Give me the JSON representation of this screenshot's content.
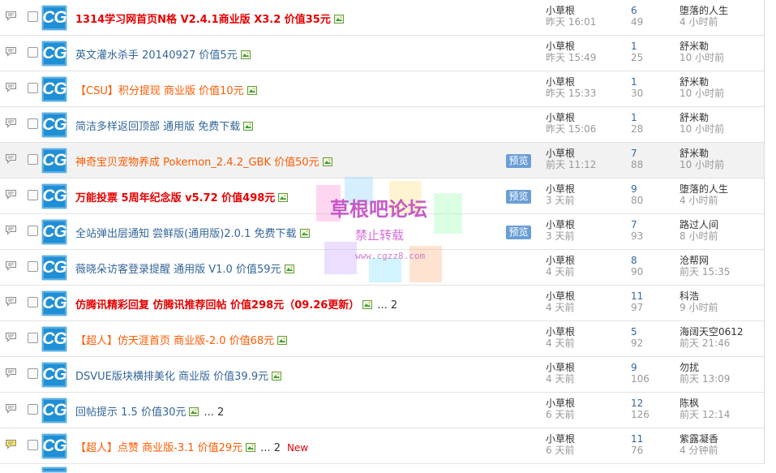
{
  "threads": [
    {
      "title": "1314学习网首页N格 V2.4.1商业版 X3.2 价值35元",
      "style": "red bold",
      "author": "小草根",
      "date": "昨天 16:01",
      "replies": "6",
      "views": "49",
      "last_user": "堕落的人生",
      "last_time": "4 小时前"
    },
    {
      "title": "英文灌水杀手 20140927 价值5元",
      "style": "",
      "author": "小草根",
      "date": "昨天 15:49",
      "replies": "1",
      "views": "25",
      "last_user": "舒米勒",
      "last_time": "10 小时前"
    },
    {
      "title": "【CSU】积分提现 商业版 价值10元",
      "style": "orange",
      "author": "小草根",
      "date": "昨天 15:33",
      "replies": "1",
      "views": "30",
      "last_user": "舒米勒",
      "last_time": "10 小时前"
    },
    {
      "title": "简洁多样返回顶部 通用版 免费下载",
      "style": "",
      "author": "小草根",
      "date": "昨天 15:06",
      "replies": "1",
      "views": "28",
      "last_user": "舒米勒",
      "last_time": "10 小时前"
    },
    {
      "title": "神奇宝贝宠物养成 Pokemon_2.4.2_GBK 价值50元",
      "style": "orange",
      "author": "小草根",
      "date": "前天 11:12",
      "replies": "7",
      "views": "88",
      "last_user": "舒米勒",
      "last_time": "10 小时前",
      "preview": "预览",
      "highlight": true
    },
    {
      "title": "万能投票 5周年纪念版 v5.72 价值498元",
      "style": "red bold",
      "author": "小草根",
      "date": "3 天前",
      "replies": "9",
      "views": "80",
      "last_user": "堕落的人生",
      "last_time": "4 小时前",
      "preview": "预览"
    },
    {
      "title": "全站弹出层通知 尝鲜版(通用版)2.0.1 免费下载",
      "style": "",
      "author": "小草根",
      "date": "3 天前",
      "replies": "7",
      "views": "93",
      "last_user": "路过人间",
      "last_time": "8 小时前",
      "preview": "预览"
    },
    {
      "title": "薇晓朵访客登录提醒 通用版 V1.0 价值59元",
      "style": "",
      "author": "小草根",
      "date": "4 天前",
      "replies": "8",
      "views": "90",
      "last_user": "沧帮网",
      "last_time": "前天 15:35"
    },
    {
      "title": "仿腾讯精彩回复 仿腾讯推荐回帖 价值298元（09.26更新）",
      "style": "red bold",
      "author": "小草根",
      "date": "4 天前",
      "replies": "11",
      "views": "97",
      "last_user": "科浩",
      "last_time": "9 小时前",
      "pages": "... 2"
    },
    {
      "title": "【超人】仿天涯首页 商业版-2.0 价值68元",
      "style": "orange",
      "author": "小草根",
      "date": "4 天前",
      "replies": "5",
      "views": "92",
      "last_user": "海阔天空0612",
      "last_time": "前天 21:46"
    },
    {
      "title": "DSVUE版块横排美化 商业版 价值39.9元",
      "style": "",
      "author": "小草根",
      "date": "4 天前",
      "replies": "9",
      "views": "106",
      "last_user": "勿扰",
      "last_time": "前天 13:09"
    },
    {
      "title": "回帖提示 1.5 价值30元",
      "style": "",
      "author": "小草根",
      "date": "6 天前",
      "replies": "12",
      "views": "126",
      "last_user": "陈枫",
      "last_time": "前天 12:14",
      "pages": "... 2"
    },
    {
      "title": "【超人】点赞 商业版-3.1 价值29元",
      "style": "orange",
      "author": "小草根",
      "date": "6 天前",
      "replies": "11",
      "views": "76",
      "last_user": "紫露凝香",
      "last_time": "4 分钟前",
      "pages": "... 2",
      "new": "New",
      "yellow_icon": true
    }
  ],
  "logo_text": "CG",
  "watermark": {
    "line1": "草根吧论坛",
    "line2": "禁止转载",
    "line3": "www.cgzz8.com"
  },
  "colors": {
    "link": "#336699",
    "red": "#e60000",
    "orange": "#ff5a00",
    "preview_bg": "#6a9ed6"
  }
}
